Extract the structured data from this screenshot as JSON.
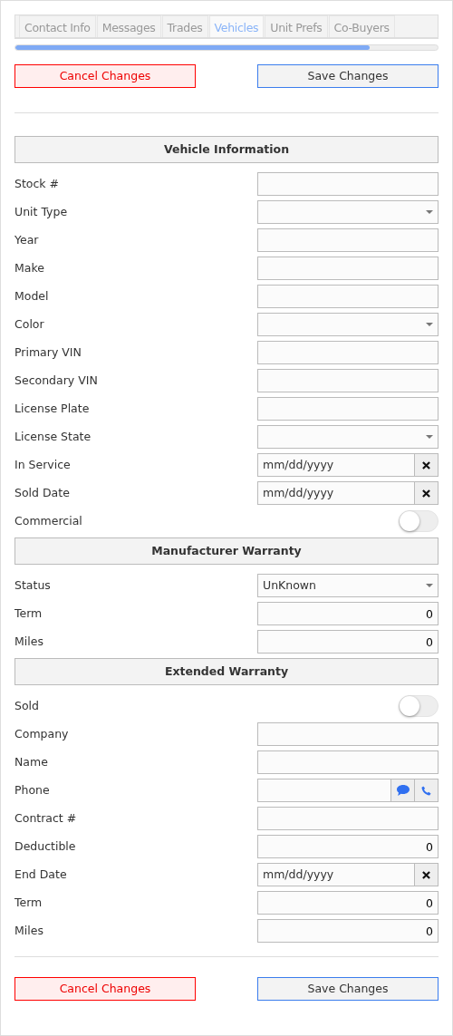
{
  "tabs": [
    {
      "label": "Contact Info",
      "selected": false
    },
    {
      "label": "Messages",
      "selected": false
    },
    {
      "label": "Trades",
      "selected": false
    },
    {
      "label": "Vehicles",
      "selected": true
    },
    {
      "label": "Unit Prefs",
      "selected": false
    },
    {
      "label": "Co-Buyers",
      "selected": false
    }
  ],
  "progress": {
    "level": 0.84
  },
  "top_buttons": {
    "cancel": "Cancel Changes",
    "save": "Save Changes"
  },
  "sections": [
    {
      "title": "Vehicle Information",
      "fields": [
        {
          "kind": "text",
          "label": "Stock #"
        },
        {
          "kind": "select",
          "label": "Unit Type"
        },
        {
          "kind": "text",
          "label": "Year"
        },
        {
          "kind": "text",
          "label": "Make"
        },
        {
          "kind": "text",
          "label": "Model"
        },
        {
          "kind": "select",
          "label": "Color"
        },
        {
          "kind": "text",
          "label": "Primary VIN"
        },
        {
          "kind": "text",
          "label": "Secondary VIN"
        },
        {
          "kind": "text",
          "label": "License Plate"
        },
        {
          "kind": "select",
          "label": "License State"
        },
        {
          "kind": "date",
          "label": "In Service",
          "placeholder": "mm/dd/yyyy"
        },
        {
          "kind": "date",
          "label": "Sold Date",
          "placeholder": "mm/dd/yyyy"
        },
        {
          "kind": "toggle",
          "label": "Commercial",
          "on": false
        }
      ]
    },
    {
      "title": "Manufacturer Warranty",
      "fields": [
        {
          "kind": "select",
          "label": "Status",
          "value": "UnKnown"
        },
        {
          "kind": "number",
          "label": "Term",
          "value": "0"
        },
        {
          "kind": "number",
          "label": "Miles",
          "value": "0"
        }
      ]
    },
    {
      "title": "Extended Warranty",
      "fields": [
        {
          "kind": "toggle",
          "label": "Sold",
          "on": false
        },
        {
          "kind": "text",
          "label": "Company"
        },
        {
          "kind": "text",
          "label": "Name"
        },
        {
          "kind": "phone",
          "label": "Phone"
        },
        {
          "kind": "text",
          "label": "Contract #"
        },
        {
          "kind": "number",
          "label": "Deductible",
          "value": "0"
        },
        {
          "kind": "date",
          "label": "End Date",
          "placeholder": "mm/dd/yyyy"
        },
        {
          "kind": "number",
          "label": "Term",
          "value": "0"
        },
        {
          "kind": "number",
          "label": "Miles",
          "value": "0"
        }
      ]
    }
  ],
  "bottom_buttons": {
    "cancel": "Cancel Changes",
    "save": "Save Changes"
  }
}
